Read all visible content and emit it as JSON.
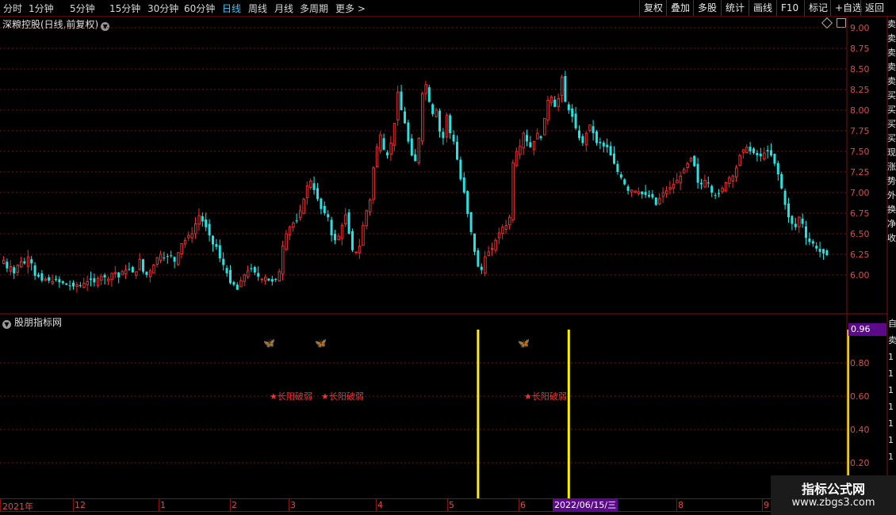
{
  "toolbar": {
    "periods": [
      "分时",
      "1分钟",
      "5分钟",
      "15分钟",
      "30分钟",
      "60分钟",
      "日线",
      "周线",
      "月线",
      "多周期",
      "更多 >"
    ],
    "active": "日线",
    "right_buttons": [
      "复权",
      "叠加",
      "多股",
      "统计",
      "画线",
      "F10",
      "标记",
      "+自选",
      "返回"
    ]
  },
  "main_title": "深粮控股(日线,前复权)",
  "price_axis": [
    "9.00",
    "8.75",
    "8.50",
    "8.25",
    "8.00",
    "7.75",
    "7.50",
    "7.25",
    "7.00",
    "6.75",
    "6.50",
    "6.25",
    "6.00"
  ],
  "indicator": {
    "title": "股朋指标网",
    "axis": [
      "0.80",
      "0.60",
      "0.40",
      "0.20"
    ],
    "value_box": "0.96",
    "signal_text": "长阳破弱"
  },
  "date_axis": {
    "labels": [
      "2021年",
      "12",
      "1",
      "2",
      "3",
      "4",
      "5",
      "6",
      "8",
      "9"
    ],
    "cursor": "2022/06/15/三"
  },
  "side_ticker": "卖卖卖卖卖买买买买现涨势外换净收",
  "side_ticker2": "自卖1111111",
  "watermark": {
    "title": "指标公式网",
    "url": "www.zbgs3.com"
  },
  "colors": {
    "up": "#e8302f",
    "down": "#1fe6e6",
    "signal": "#ffee00",
    "grid": "#7a1010"
  },
  "chart_data": {
    "type": "candlestick",
    "ylim": [
      5.8,
      9.05
    ],
    "ylabel": "",
    "close": [
      6.18,
      6.08,
      6.1,
      6.02,
      6.12,
      6.16,
      6.14,
      6.22,
      6.14,
      5.99,
      5.98,
      5.93,
      5.95,
      5.93,
      5.92,
      5.94,
      5.91,
      5.9,
      5.88,
      5.87,
      5.86,
      5.88,
      5.87,
      5.9,
      5.92,
      5.94,
      5.91,
      5.96,
      5.98,
      5.97,
      5.95,
      6.02,
      6.03,
      5.97,
      6.04,
      6.06,
      6.07,
      6.03,
      6.04,
      6.19,
      6.04,
      6.0,
      6.05,
      6.12,
      6.21,
      6.25,
      6.21,
      6.22,
      6.23,
      6.16,
      6.27,
      6.38,
      6.42,
      6.48,
      6.5,
      6.62,
      6.72,
      6.65,
      6.58,
      6.48,
      6.37,
      6.34,
      6.2,
      6.12,
      6.02,
      5.9,
      5.88,
      5.82,
      5.93,
      6.0,
      6.05,
      6.07,
      6.03,
      5.98,
      5.95,
      5.97,
      5.93,
      5.92,
      5.95,
      6.04,
      6.35,
      6.5,
      6.58,
      6.63,
      6.66,
      6.78,
      6.92,
      7.08,
      7.14,
      7.03,
      6.92,
      6.8,
      6.75,
      6.7,
      6.48,
      6.42,
      6.47,
      6.6,
      6.73,
      6.5,
      6.3,
      6.28,
      6.35,
      6.6,
      6.78,
      6.91,
      7.3,
      7.55,
      7.7,
      7.52,
      7.45,
      7.6,
      7.84,
      8.22,
      8.0,
      7.84,
      7.62,
      7.45,
      7.38,
      7.66,
      8.2,
      8.31,
      8.1,
      7.95,
      8.0,
      7.74,
      7.66,
      7.94,
      7.72,
      7.62,
      7.4,
      7.16,
      7.0,
      6.74,
      6.52,
      6.28,
      6.1,
      6.06,
      6.22,
      6.28,
      6.32,
      6.42,
      6.51,
      6.58,
      6.6,
      6.7,
      7.36,
      7.5,
      7.56,
      7.72,
      7.62,
      7.55,
      7.62,
      7.72,
      7.66,
      7.9,
      8.12,
      8.16,
      8.04,
      8.14,
      8.4,
      8.1,
      8.0,
      7.92,
      7.78,
      7.66,
      7.6,
      7.72,
      7.82,
      7.72,
      7.6,
      7.6,
      7.56,
      7.55,
      7.45,
      7.35,
      7.25,
      7.18,
      7.1,
      7.02,
      7.03,
      7.02,
      7.01,
      6.98,
      6.97,
      6.95,
      6.94,
      6.85,
      6.93,
      7.0,
      7.02,
      7.06,
      7.1,
      7.15,
      7.2,
      7.28,
      7.35,
      7.42,
      7.32,
      7.12,
      7.1,
      7.15,
      7.12,
      7.0,
      6.96,
      6.99,
      7.05,
      7.12,
      7.18,
      7.2,
      7.3,
      7.45,
      7.52,
      7.55,
      7.5,
      7.48,
      7.45,
      7.44,
      7.48,
      7.5,
      7.45,
      7.35,
      7.22,
      7.05,
      6.85,
      6.7,
      6.62,
      6.58,
      6.7,
      6.62,
      6.45,
      6.4,
      6.38,
      6.32,
      6.28,
      6.26,
      6.24
    ],
    "signal_days": [
      136,
      162,
      242
    ]
  }
}
